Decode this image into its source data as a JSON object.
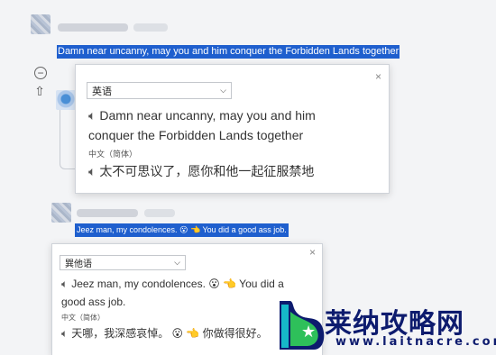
{
  "comment1": {
    "selected_text": "Damn near uncanny, may you and him conquer the Forbidden Lands together"
  },
  "popup1": {
    "source_language": "英语",
    "source_text_line1": "Damn near uncanny, may you and him",
    "source_text_line2": "conquer the Forbidden Lands together",
    "target_language": "中文（简体）",
    "translation": "太不可思议了，愿你和他一起征服禁地"
  },
  "comment2": {
    "selected_text": "Jeez man, my condolences. 😮 👈 You did a good ass job."
  },
  "popup2": {
    "source_language": "巽他语",
    "source_text_line1": "Jeez man, my condolences. 😮 👈 You did a",
    "source_text_line2": "good ass job.",
    "target_language": "中文（简体）",
    "translation": "天哪，我深感哀悼。 😮 👈 你做得很好。"
  },
  "watermark": {
    "title": "莱纳攻略网",
    "url": "www.laitnacre.com"
  },
  "colors": {
    "selection": "#1f5fce",
    "brand": "#0d1b6e"
  },
  "icons": {
    "collapse": "minus-circle-icon",
    "upvote": "up-arrow-icon",
    "speaker": "speaker-icon",
    "close": "close-icon"
  }
}
